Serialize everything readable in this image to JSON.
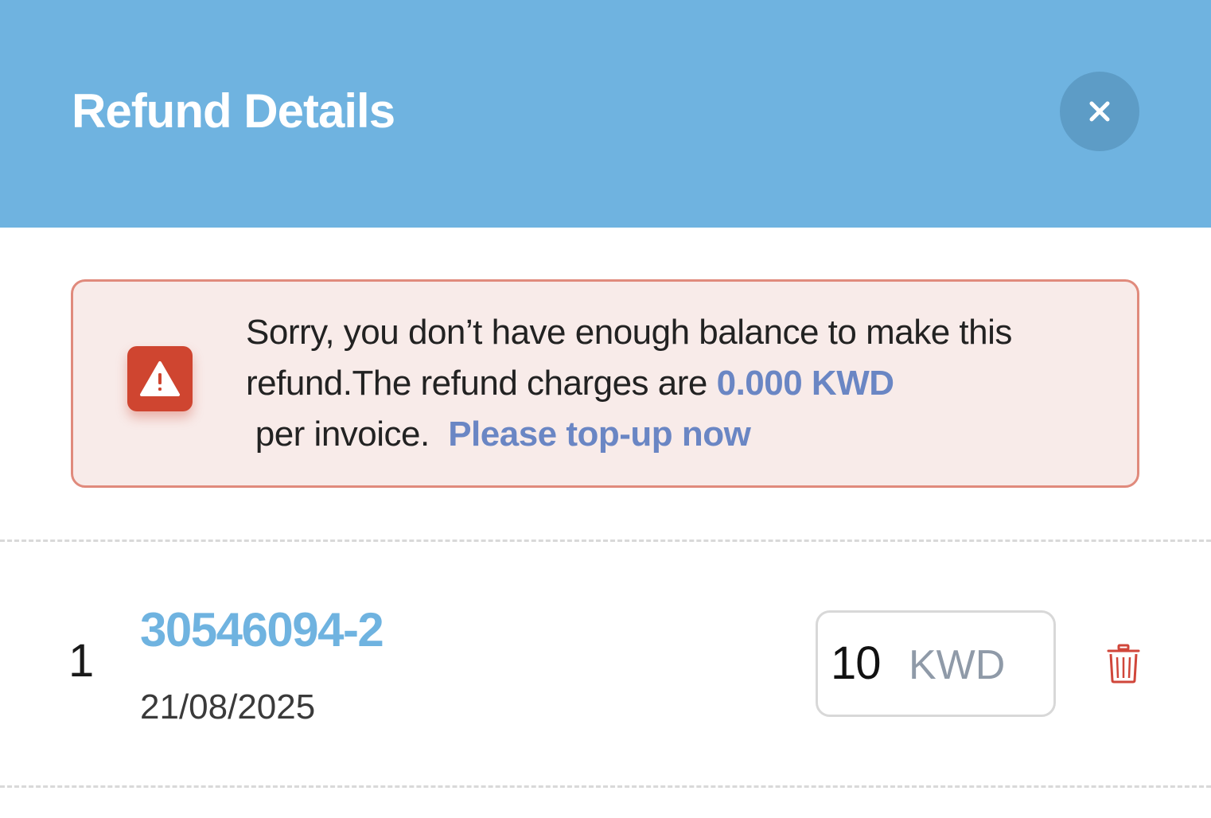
{
  "modal": {
    "title": "Refund Details",
    "close_icon": "close-icon"
  },
  "alert": {
    "icon": "warning-icon",
    "text_before": "Sorry, you don’t have enough balance to make this refund.The refund charges are ",
    "amount": "0.000 KWD",
    "text_after": " per invoice.  ",
    "link_label": "Please top-up now",
    "colors": {
      "background": "#f8ebe9",
      "border": "#e08a7c",
      "icon_bg": "#cf4530",
      "highlight": "#6a86c4"
    }
  },
  "refund_items": [
    {
      "index": "1",
      "invoice_id": "30546094-2",
      "date": "21/08/2025",
      "amount": "10",
      "currency": "KWD",
      "delete_icon": "trash-icon"
    }
  ],
  "colors": {
    "header": "#6fb3e0",
    "close_button": "#5d9cc6",
    "invoice_link": "#6fb3e0",
    "delete": "#d0463a"
  }
}
